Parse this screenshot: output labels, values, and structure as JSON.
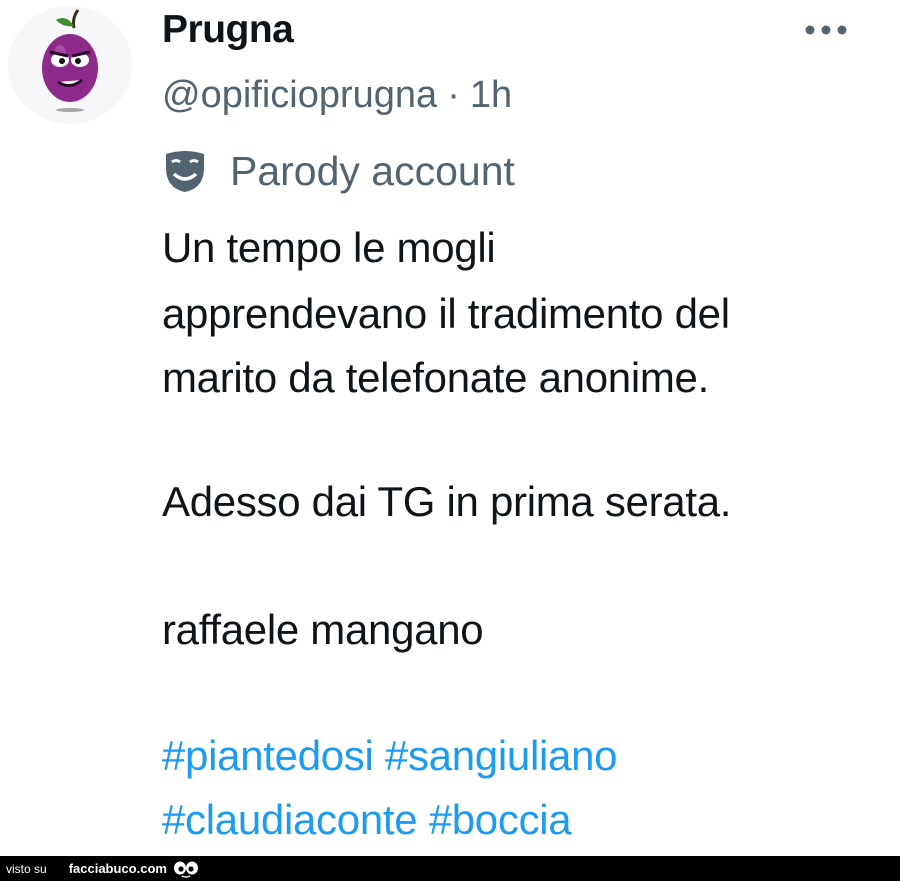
{
  "tweet": {
    "author": {
      "display_name": "Prugna",
      "handle": "@opificioprugna",
      "separator": "·",
      "time": "1h",
      "avatar_icon": "plum-character-avatar"
    },
    "more_icon": "more-horizontal-icon",
    "label": {
      "icon": "parody-mask-icon",
      "text": "Parody account"
    },
    "text_lines": [
      "Un tempo le mogli",
      "apprendevano il tradimento del",
      "marito da telefonate anonime.",
      "Adesso dai TG in prima serata.",
      "raffaele mangano"
    ],
    "hashtags": [
      "#piantedosi",
      "#sangiuliano",
      "#claudiaconte",
      "#boccia"
    ],
    "colors": {
      "text": "#0f1419",
      "secondary": "#536471",
      "hashtag": "#1d9bf0",
      "plum": "#8e2a8a"
    }
  },
  "watermark": {
    "prefix": "visto su",
    "site": "facciabuco.com",
    "logo_icon": "eyes-logo-icon"
  }
}
